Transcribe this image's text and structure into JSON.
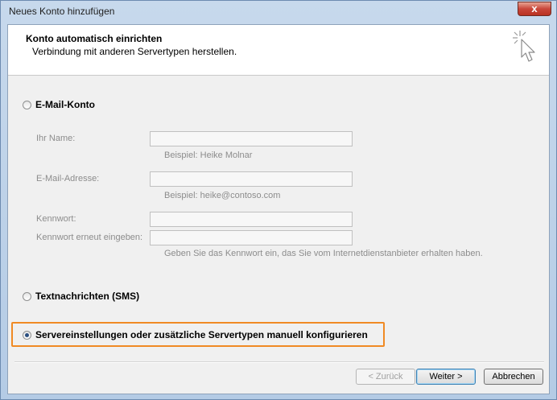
{
  "window": {
    "title": "Neues Konto hinzufügen",
    "close_glyph": "x"
  },
  "header": {
    "title": "Konto automatisch einrichten",
    "subtitle": "Verbindung mit anderen Servertypen herstellen."
  },
  "options": {
    "email": {
      "label": "E-Mail-Konto",
      "checked": false
    },
    "sms": {
      "label": "Textnachrichten (SMS)",
      "checked": false
    },
    "manual": {
      "label": "Servereinstellungen oder zusätzliche Servertypen manuell konfigurieren",
      "checked": true
    }
  },
  "fields": {
    "name": {
      "label": "Ihr Name:",
      "value": "",
      "hint": "Beispiel: Heike Molnar"
    },
    "email": {
      "label": "E-Mail-Adresse:",
      "value": "",
      "hint": "Beispiel: heike@contoso.com"
    },
    "password": {
      "label": "Kennwort:",
      "value": ""
    },
    "password_repeat": {
      "label": "Kennwort erneut eingeben:",
      "value": "",
      "hint": "Geben Sie das Kennwort ein, das Sie vom Internetdienstanbieter erhalten haben."
    }
  },
  "buttons": {
    "back": "< Zurück",
    "next": "Weiter >",
    "cancel": "Abbrechen"
  },
  "colors": {
    "highlight": "#f08a24"
  }
}
